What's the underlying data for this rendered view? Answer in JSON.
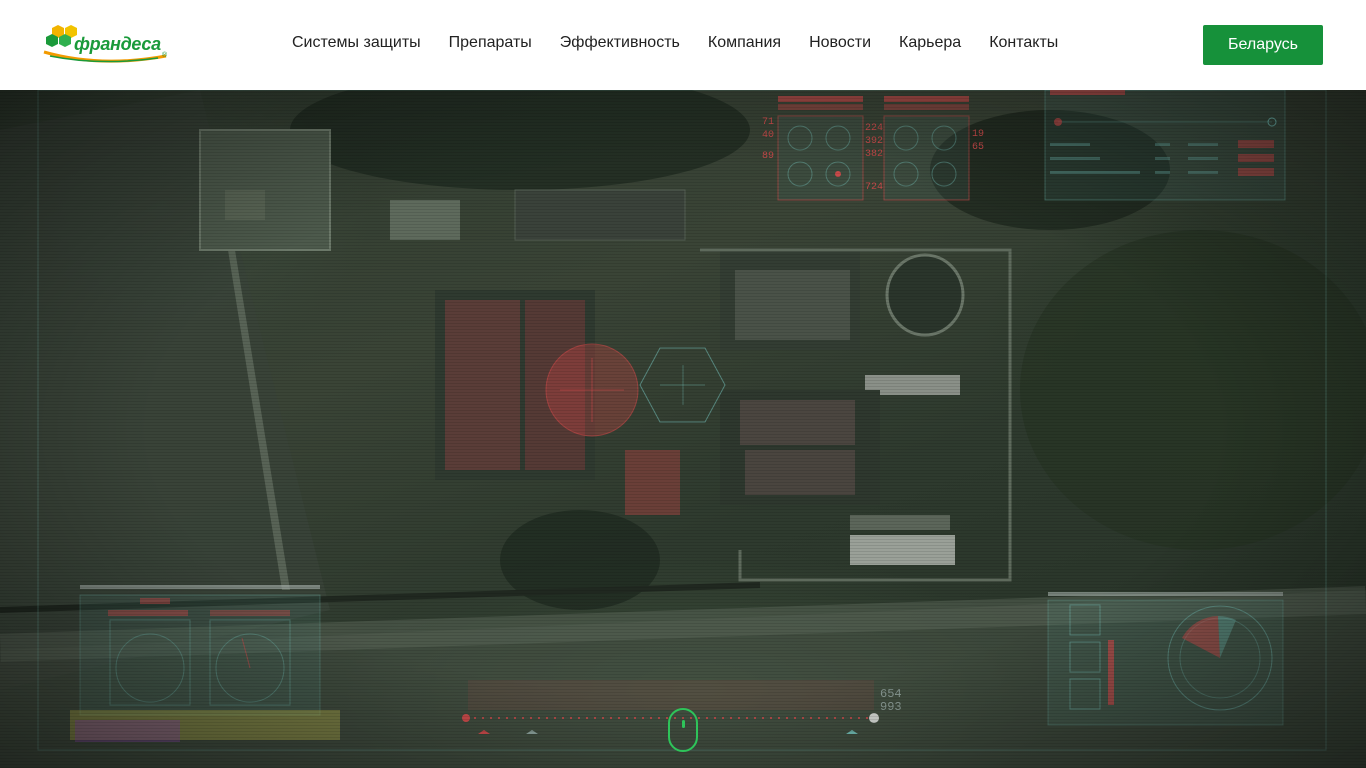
{
  "header": {
    "logo_text": "франдеса",
    "logo_mark": "®",
    "nav": [
      {
        "label": "Системы защиты"
      },
      {
        "label": "Препараты"
      },
      {
        "label": "Эффективность"
      },
      {
        "label": "Компания"
      },
      {
        "label": "Новости"
      },
      {
        "label": "Карьера"
      },
      {
        "label": "Контакты"
      }
    ],
    "country_button": "Беларусь"
  },
  "hero": {
    "hud_left_numbers": [
      "71",
      "40",
      "89"
    ],
    "hud_mid_numbers": [
      "224",
      "392",
      "382",
      "724"
    ],
    "hud_right_numbers": [
      "19",
      "65"
    ],
    "altitude_readout": [
      "654",
      "993"
    ],
    "scroll_icon": "mouse-scroll-icon"
  },
  "colors": {
    "brand_green": "#16913a",
    "hud_red": "#c84a4a",
    "hud_cyan": "#6fb8b0"
  }
}
